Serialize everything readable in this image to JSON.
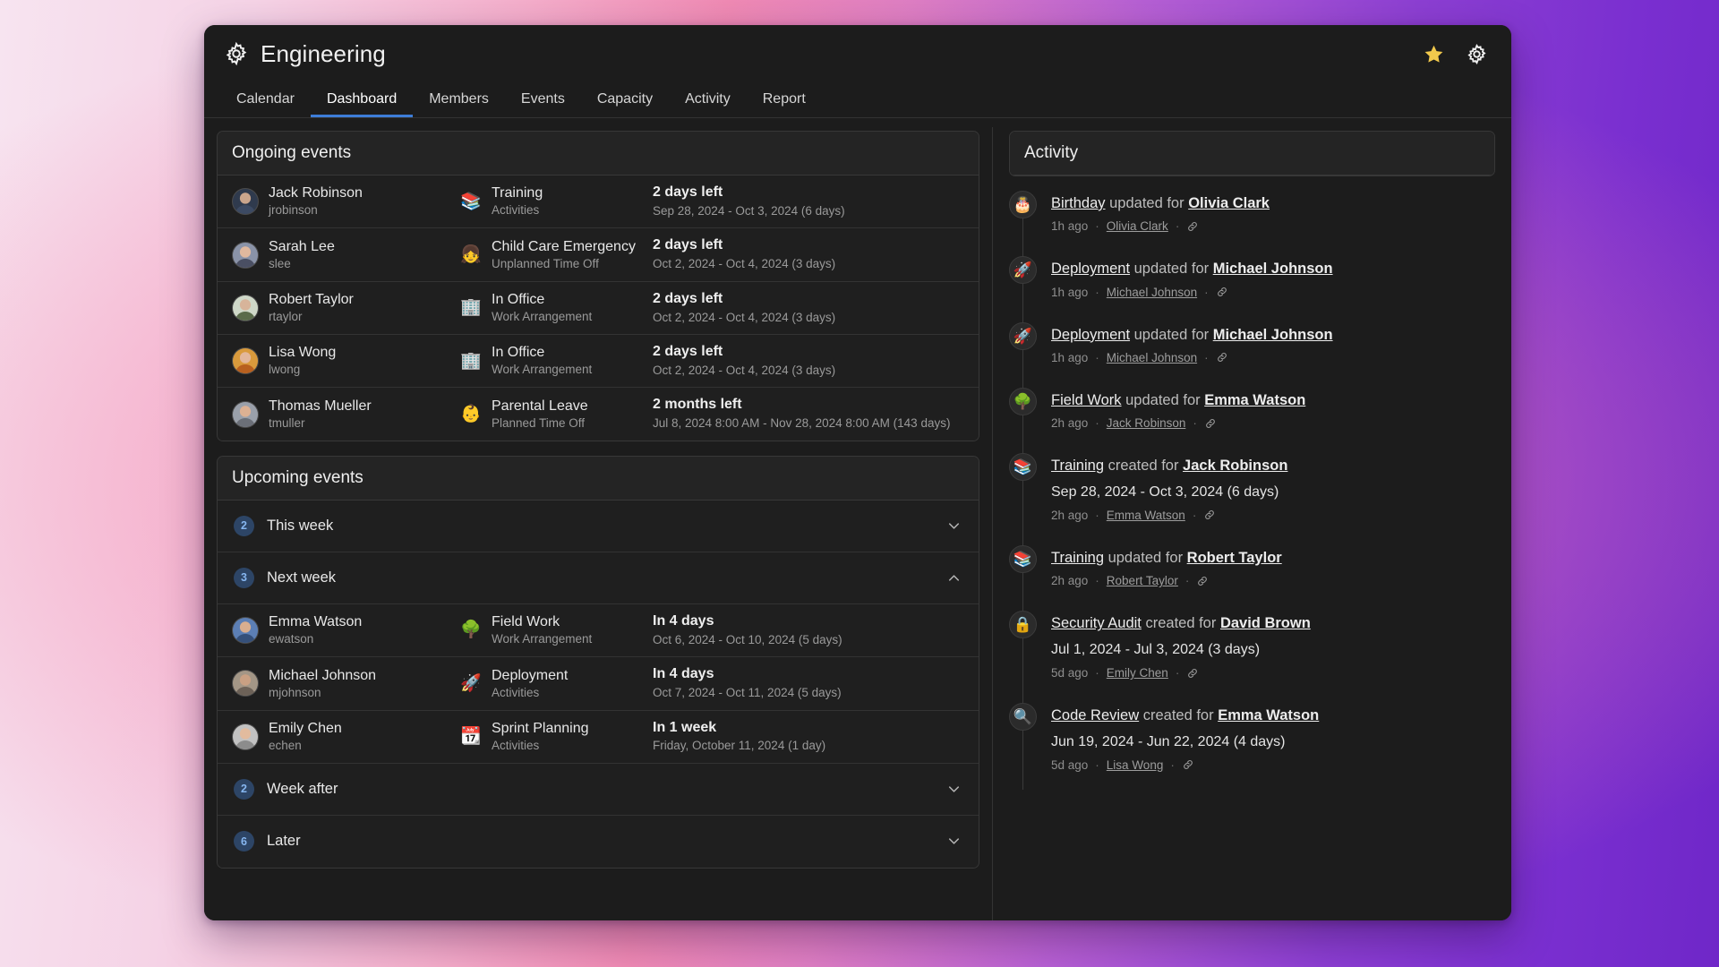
{
  "header": {
    "title": "Engineering",
    "gear_icon": "gear-icon",
    "star_icon": "star-icon",
    "settings_icon": "gear-icon"
  },
  "tabs": [
    {
      "label": "Calendar",
      "active": false
    },
    {
      "label": "Dashboard",
      "active": true
    },
    {
      "label": "Members",
      "active": false
    },
    {
      "label": "Events",
      "active": false
    },
    {
      "label": "Capacity",
      "active": false
    },
    {
      "label": "Activity",
      "active": false
    },
    {
      "label": "Report",
      "active": false
    }
  ],
  "ongoing": {
    "title": "Ongoing events",
    "rows": [
      {
        "name": "Jack Robinson",
        "username": "jrobinson",
        "event": "Training",
        "category": "Activities",
        "emoji": "📚",
        "left": "2 days left",
        "range": "Sep 28, 2024 - Oct 3, 2024 (6 days)"
      },
      {
        "name": "Sarah Lee",
        "username": "slee",
        "event": "Child Care Emergency",
        "category": "Unplanned Time Off",
        "emoji": "👧",
        "left": "2 days left",
        "range": "Oct 2, 2024 - Oct 4, 2024 (3 days)"
      },
      {
        "name": "Robert Taylor",
        "username": "rtaylor",
        "event": "In Office",
        "category": "Work Arrangement",
        "emoji": "🏢",
        "left": "2 days left",
        "range": "Oct 2, 2024 - Oct 4, 2024 (3 days)"
      },
      {
        "name": "Lisa Wong",
        "username": "lwong",
        "event": "In Office",
        "category": "Work Arrangement",
        "emoji": "🏢",
        "left": "2 days left",
        "range": "Oct 2, 2024 - Oct 4, 2024 (3 days)"
      },
      {
        "name": "Thomas Mueller",
        "username": "tmuller",
        "event": "Parental Leave",
        "category": "Planned Time Off",
        "emoji": "👶",
        "left": "2 months left",
        "range": "Jul 8, 2024 8:00 AM - Nov 28, 2024 8:00 AM (143 days)"
      }
    ]
  },
  "upcoming": {
    "title": "Upcoming events",
    "groups": [
      {
        "count": "2",
        "label": "This week",
        "expanded": false,
        "chevron": "chevron-down-icon",
        "rows": []
      },
      {
        "count": "3",
        "label": "Next week",
        "expanded": true,
        "chevron": "chevron-up-icon",
        "rows": [
          {
            "name": "Emma Watson",
            "username": "ewatson",
            "event": "Field Work",
            "category": "Work Arrangement",
            "emoji": "🌳",
            "left": "In 4 days",
            "range": "Oct 6, 2024 - Oct 10, 2024 (5 days)"
          },
          {
            "name": "Michael Johnson",
            "username": "mjohnson",
            "event": "Deployment",
            "category": "Activities",
            "emoji": "🚀",
            "left": "In 4 days",
            "range": "Oct 7, 2024 - Oct 11, 2024 (5 days)"
          },
          {
            "name": "Emily Chen",
            "username": "echen",
            "event": "Sprint Planning",
            "category": "Activities",
            "emoji": "📆",
            "left": "In 1 week",
            "range": "Friday, October 11, 2024 (1 day)"
          }
        ]
      },
      {
        "count": "2",
        "label": "Week after",
        "expanded": false,
        "chevron": "chevron-down-icon",
        "rows": []
      },
      {
        "count": "6",
        "label": "Later",
        "expanded": false,
        "chevron": "chevron-down-icon",
        "rows": []
      }
    ]
  },
  "activity": {
    "title": "Activity",
    "items": [
      {
        "emoji": "🎂",
        "subject": "Birthday",
        "verb": " updated for ",
        "target": "Olivia Clark",
        "range": "",
        "time": "1h ago",
        "author": "Olivia Clark",
        "link_icon": "link-icon"
      },
      {
        "emoji": "🚀",
        "subject": "Deployment",
        "verb": " updated for ",
        "target": "Michael Johnson",
        "range": "",
        "time": "1h ago",
        "author": "Michael Johnson",
        "link_icon": "link-icon"
      },
      {
        "emoji": "🚀",
        "subject": "Deployment",
        "verb": " updated for ",
        "target": "Michael Johnson",
        "range": "",
        "time": "1h ago",
        "author": "Michael Johnson",
        "link_icon": "link-icon"
      },
      {
        "emoji": "🌳",
        "subject": "Field Work",
        "verb": " updated for ",
        "target": "Emma Watson",
        "range": "",
        "time": "2h ago",
        "author": "Jack Robinson",
        "link_icon": "link-icon"
      },
      {
        "emoji": "📚",
        "subject": "Training",
        "verb": " created for ",
        "target": "Jack Robinson",
        "range": "Sep 28, 2024 - Oct 3, 2024 (6 days)",
        "time": "2h ago",
        "author": "Emma Watson",
        "link_icon": "link-icon"
      },
      {
        "emoji": "📚",
        "subject": "Training",
        "verb": " updated for ",
        "target": "Robert Taylor",
        "range": "",
        "time": "2h ago",
        "author": "Robert Taylor",
        "link_icon": "link-icon"
      },
      {
        "emoji": "🔒",
        "subject": "Security Audit",
        "verb": " created for ",
        "target": "David Brown",
        "range": "Jul 1, 2024 - Jul 3, 2024 (3 days)",
        "time": "5d ago",
        "author": "Emily Chen",
        "link_icon": "link-icon"
      },
      {
        "emoji": "🔍",
        "subject": "Code Review",
        "verb": " created for ",
        "target": "Emma Watson",
        "range": "Jun 19, 2024 - Jun 22, 2024 (4 days)",
        "time": "5d ago",
        "author": "Lisa Wong",
        "link_icon": "link-icon"
      }
    ]
  },
  "colors": {
    "accent": "#3d7dd8",
    "badge_bg": "#2d4566",
    "badge_text": "#86b6f0",
    "star": "#f2c94c",
    "window_bg": "#1c1c1c",
    "card_bg": "#242424"
  }
}
